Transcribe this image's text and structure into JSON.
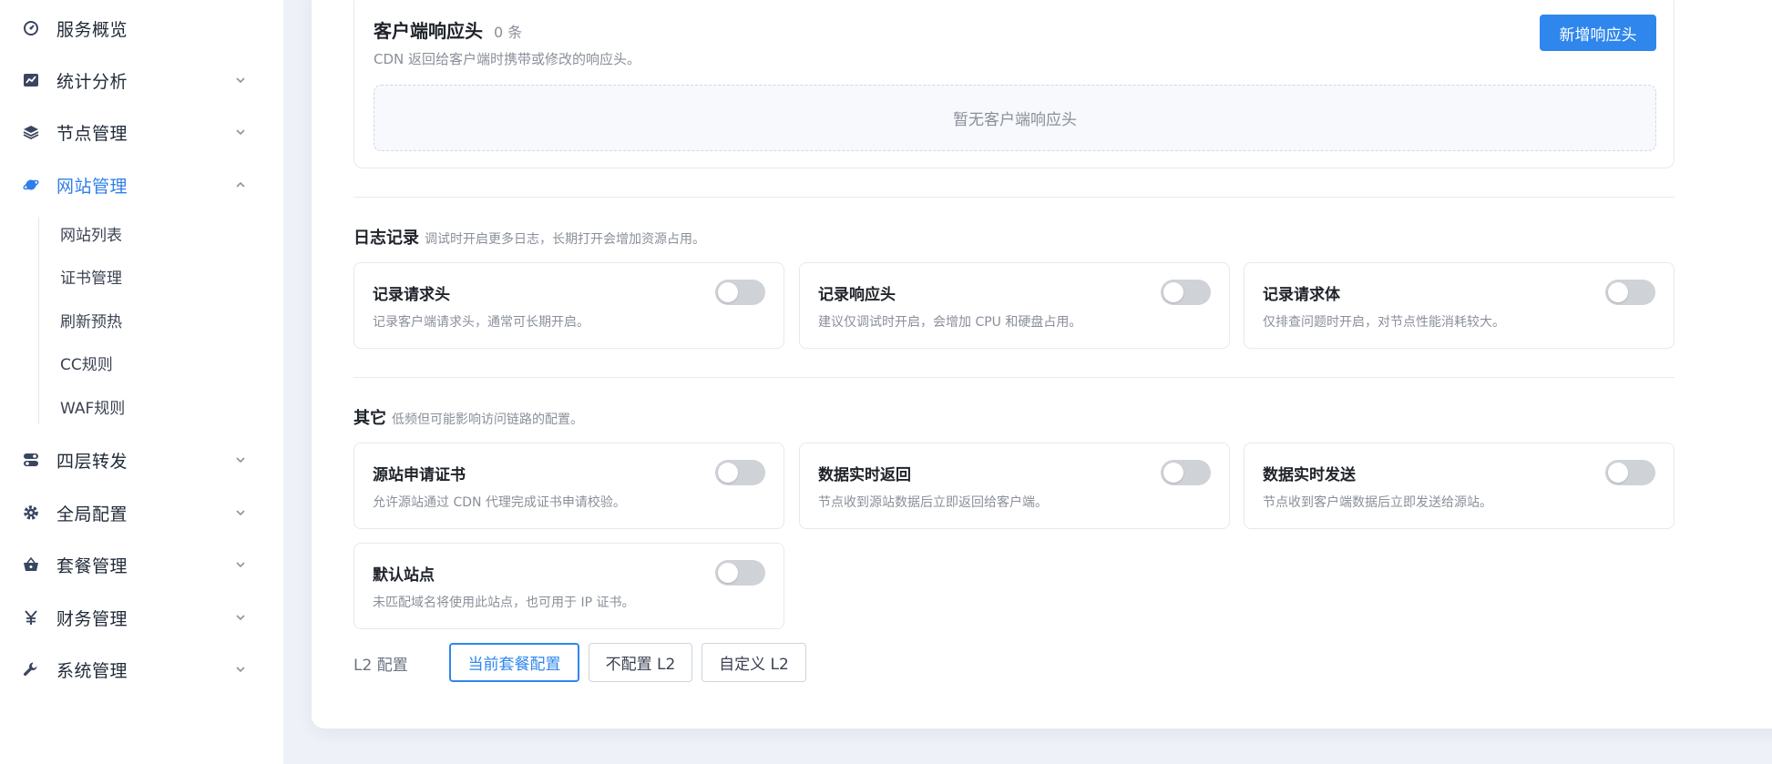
{
  "sidebar": {
    "items": [
      {
        "label": "服务概览",
        "icon": "dashboard-icon"
      },
      {
        "label": "统计分析",
        "icon": "chart-icon"
      },
      {
        "label": "节点管理",
        "icon": "layers-icon"
      },
      {
        "label": "网站管理",
        "icon": "planet-icon"
      },
      {
        "label": "四层转发",
        "icon": "toggle-stack-icon"
      },
      {
        "label": "全局配置",
        "icon": "gear-icon"
      },
      {
        "label": "套餐管理",
        "icon": "basket-icon"
      },
      {
        "label": "财务管理",
        "icon": "yen-icon"
      },
      {
        "label": "系统管理",
        "icon": "wrench-icon"
      }
    ],
    "subitems": [
      "网站列表",
      "证书管理",
      "刷新预热",
      "CC规则",
      "WAF规则"
    ],
    "active_color": "#2f7fe8"
  },
  "response_headers": {
    "title": "客户端响应头",
    "count": "0 条",
    "desc": "CDN 返回给客户端时携带或修改的响应头。",
    "add_label": "新增响应头",
    "empty_text": "暂无客户端响应头"
  },
  "log_section": {
    "title": "日志记录",
    "hint": "调试时开启更多日志，长期打开会增加资源占用。",
    "cards": [
      {
        "title": "记录请求头",
        "desc": "记录客户端请求头，通常可长期开启。"
      },
      {
        "title": "记录响应头",
        "desc": "建议仅调试时开启，会增加 CPU 和硬盘占用。"
      },
      {
        "title": "记录请求体",
        "desc": "仅排查问题时开启，对节点性能消耗较大。"
      }
    ]
  },
  "other_section": {
    "title": "其它",
    "hint": "低频但可能影响访问链路的配置。",
    "cards": [
      {
        "title": "源站申请证书",
        "desc": "允许源站通过 CDN 代理完成证书申请校验。"
      },
      {
        "title": "数据实时返回",
        "desc": "节点收到源站数据后立即返回给客户端。"
      },
      {
        "title": "数据实时发送",
        "desc": "节点收到客户端数据后立即发送给源站。"
      },
      {
        "title": "默认站点",
        "desc": "未匹配域名将使用此站点，也可用于 IP 证书。"
      }
    ]
  },
  "l2": {
    "label": "L2 配置",
    "options": [
      "当前套餐配置",
      "不配置 L2",
      "自定义 L2"
    ],
    "selected": "当前套餐配置"
  },
  "colors": {
    "primary": "#2f86ec",
    "toggle_off": "#cfd2d7"
  }
}
